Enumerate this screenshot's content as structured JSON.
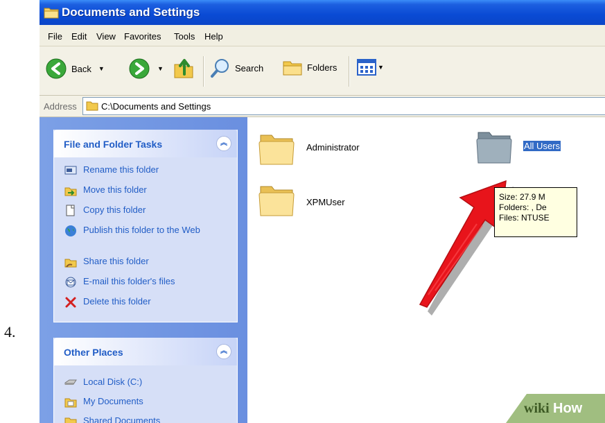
{
  "step_number": "4.",
  "window": {
    "title": "Documents and Settings"
  },
  "menu": {
    "items": [
      "File",
      "Edit",
      "View",
      "Favorites",
      "Tools",
      "Help"
    ]
  },
  "toolbar": {
    "back_label": "Back",
    "search_label": "Search",
    "folders_label": "Folders"
  },
  "address": {
    "label": "Address",
    "value": "C:\\Documents and Settings"
  },
  "tasks_panel": {
    "title": "File and Folder Tasks",
    "items": [
      {
        "label": "Rename this folder",
        "icon": "rename-icon"
      },
      {
        "label": "Move this folder",
        "icon": "move-icon"
      },
      {
        "label": "Copy this folder",
        "icon": "copy-icon"
      },
      {
        "label": "Publish this folder to the Web",
        "icon": "globe-icon"
      },
      {
        "label": "Share this folder",
        "icon": "share-icon"
      },
      {
        "label": "E-mail this folder's files",
        "icon": "email-icon"
      },
      {
        "label": "Delete this folder",
        "icon": "delete-icon"
      }
    ]
  },
  "other_places": {
    "title": "Other Places",
    "items": [
      {
        "label": "Local Disk (C:)",
        "icon": "disk-icon"
      },
      {
        "label": "My Documents",
        "icon": "folder-icon"
      },
      {
        "label": "Shared Documents",
        "icon": "folder-icon"
      }
    ]
  },
  "folders": [
    {
      "name": "Administrator",
      "selected": false
    },
    {
      "name": "XPMUser",
      "selected": false
    },
    {
      "name": "All Users",
      "selected": true
    }
  ],
  "tooltip": {
    "lines": [
      "Size: 27.9 M",
      "Folders: , De",
      "Files: NTUSE"
    ]
  },
  "watermark": {
    "wiki": "wiki",
    "how": "How"
  },
  "colors": {
    "title_bar": "#0a4ad4",
    "task_link": "#215dc6",
    "selection": "#316ac5",
    "arrow": "#e8141b"
  }
}
